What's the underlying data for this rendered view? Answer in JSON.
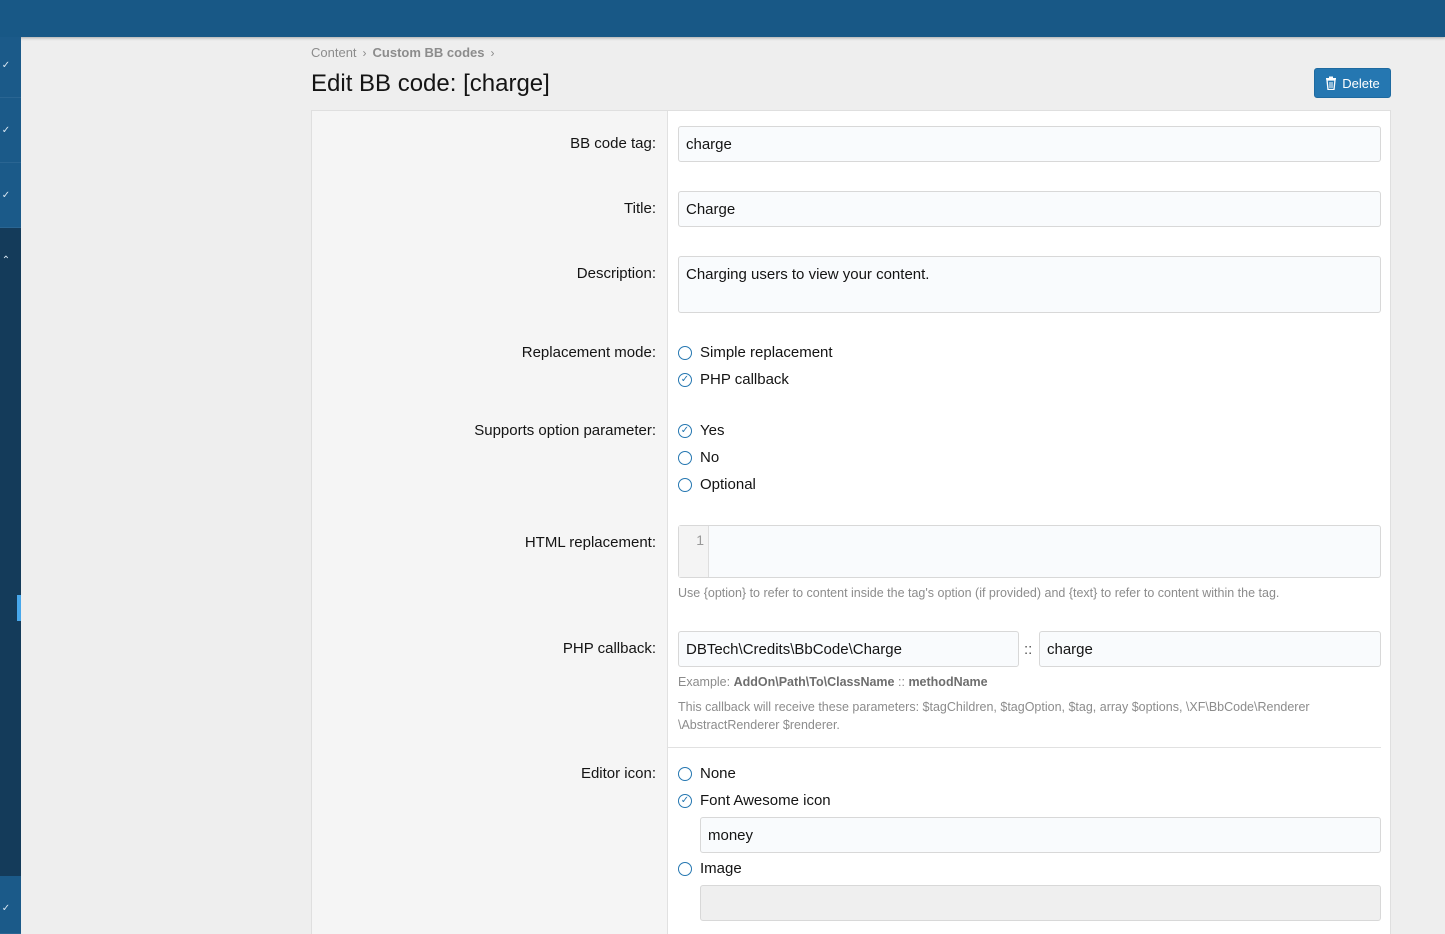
{
  "breadcrumb": {
    "items": [
      "Content",
      "Custom BB codes"
    ]
  },
  "page": {
    "title": "Edit BB code: [charge]",
    "delete_label": "Delete"
  },
  "form": {
    "tag_label": "BB code tag:",
    "tag_value": "charge",
    "title_label": "Title:",
    "title_value": "Charge",
    "description_label": "Description:",
    "description_value": "Charging users to view your content.",
    "mode_label": "Replacement mode:",
    "mode_options": [
      "Simple replacement",
      "PHP callback"
    ],
    "mode_selected": "PHP callback",
    "option_label": "Supports option parameter:",
    "option_options": [
      "Yes",
      "No",
      "Optional"
    ],
    "option_selected": "Yes",
    "html_label": "HTML replacement:",
    "html_line_number": "1",
    "html_hint": "Use {option} to refer to content inside the tag's option (if provided) and {text} to refer to content within the tag.",
    "php_label": "PHP callback:",
    "php_class": "DBTech\\Credits\\BbCode\\Charge",
    "php_separator": "::",
    "php_method": "charge",
    "php_example_prefix": "Example:",
    "php_example_class": "AddOn\\Path\\To\\ClassName",
    "php_example_sep": "::",
    "php_example_method": "methodName",
    "php_params_hint": "This callback will receive these parameters: $tagChildren, $tagOption, $tag, array $options, \\XF\\BbCode\\Renderer \\AbstractRenderer $renderer.",
    "icon_label": "Editor icon:",
    "icon_options": [
      "None",
      "Font Awesome icon",
      "Image"
    ],
    "icon_selected": "Font Awesome icon",
    "fa_value": "money",
    "image_value": ""
  },
  "colors": {
    "topbar": "#185886",
    "accent": "#2577b1",
    "sidebar": "#1c4a6e"
  },
  "icons": {
    "delete": "trash-icon",
    "chevron": "chevron-icon",
    "radio_checked": "check-icon"
  }
}
